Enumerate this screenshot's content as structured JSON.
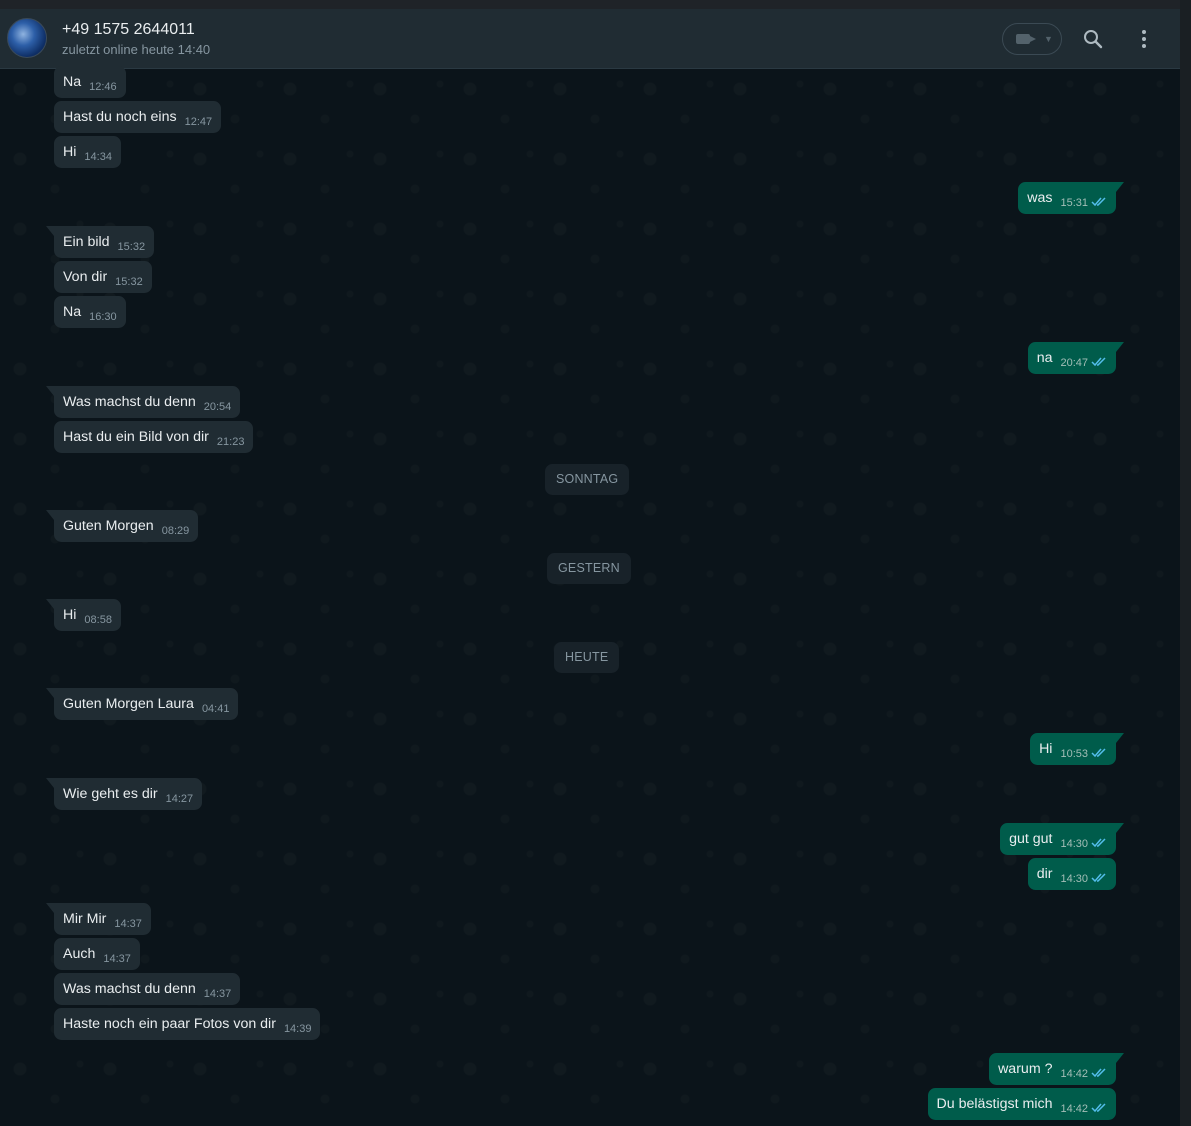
{
  "header": {
    "contact_name": "+49 1575 2644011",
    "status": "zuletzt online heute 14:40"
  },
  "messages": [
    {
      "text": "Na",
      "time": "12:46",
      "dir": "in"
    },
    {
      "text": "Hast du noch eins",
      "time": "12:47",
      "dir": "in"
    },
    {
      "text": "Hi",
      "time": "14:34",
      "dir": "in"
    },
    {
      "text": "was",
      "time": "15:31",
      "dir": "out"
    },
    {
      "text": "Ein bild",
      "time": "15:32",
      "dir": "in"
    },
    {
      "text": "Von dir",
      "time": "15:32",
      "dir": "in"
    },
    {
      "text": "Na",
      "time": "16:30",
      "dir": "in"
    },
    {
      "text": "na",
      "time": "20:47",
      "dir": "out"
    },
    {
      "text": "Was machst du denn",
      "time": "20:54",
      "dir": "in"
    },
    {
      "text": "Hast du ein Bild von dir",
      "time": "21:23",
      "dir": "in"
    },
    {
      "text": "Guten Morgen",
      "time": "08:29",
      "dir": "in"
    },
    {
      "text": "Hi",
      "time": "08:58",
      "dir": "in"
    },
    {
      "text": "Guten Morgen Laura",
      "time": "04:41",
      "dir": "in"
    },
    {
      "text": "Hi",
      "time": "10:53",
      "dir": "out"
    },
    {
      "text": "Wie geht es dir",
      "time": "14:27",
      "dir": "in"
    },
    {
      "text": "gut gut",
      "time": "14:30",
      "dir": "out"
    },
    {
      "text": "dir",
      "time": "14:30",
      "dir": "out"
    },
    {
      "text": "Mir Mir",
      "time": "14:37",
      "dir": "in"
    },
    {
      "text": "Auch",
      "time": "14:37",
      "dir": "in"
    },
    {
      "text": "Was machst du denn",
      "time": "14:37",
      "dir": "in"
    },
    {
      "text": "Haste noch ein paar Fotos von dir",
      "time": "14:39",
      "dir": "in"
    },
    {
      "text": "warum ?",
      "time": "14:42",
      "dir": "out"
    },
    {
      "text": "Du belästigst mich",
      "time": "14:42",
      "dir": "out"
    }
  ],
  "date_separators": [
    "SONNTAG",
    "GESTERN",
    "HEUTE"
  ],
  "colors": {
    "background": "#0b141a",
    "incoming_bubble": "#202c33",
    "outgoing_bubble": "#005c4b",
    "read_ticks": "#53bdeb"
  },
  "icons": [
    "video-call-icon",
    "search-icon",
    "menu-icon",
    "double-check-icon"
  ]
}
